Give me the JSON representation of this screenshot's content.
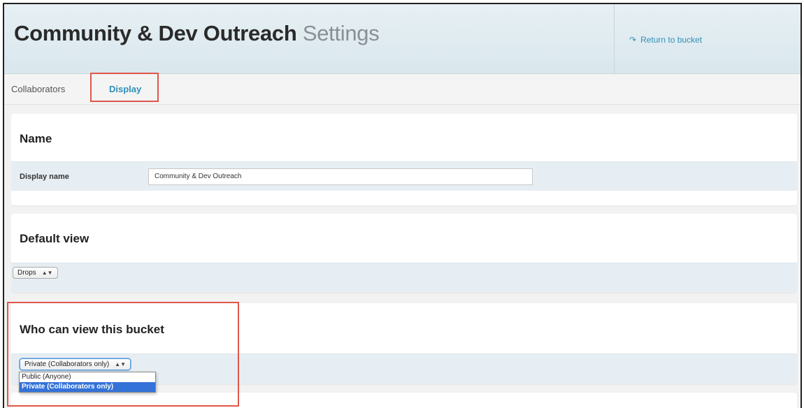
{
  "header": {
    "title_bold": "Community & Dev Outreach",
    "title_light": "Settings",
    "return_link": "Return to bucket",
    "return_icon": "return-arrow-icon"
  },
  "tabs": [
    {
      "label": "Collaborators",
      "active": false
    },
    {
      "label": "Display",
      "active": true
    }
  ],
  "name_section": {
    "heading": "Name",
    "field_label": "Display name",
    "field_value": "Community & Dev Outreach"
  },
  "default_view": {
    "heading": "Default view",
    "selected": "Drops"
  },
  "who_can_view": {
    "heading": "Who can view this bucket",
    "selected": "Private (Collaborators only)",
    "options": [
      "Public (Anyone)",
      "Private (Collaborators only)"
    ]
  },
  "colors": {
    "accent": "#2f8fb8",
    "highlight_box": "#e0564a",
    "selected_option": "#3472d8"
  }
}
